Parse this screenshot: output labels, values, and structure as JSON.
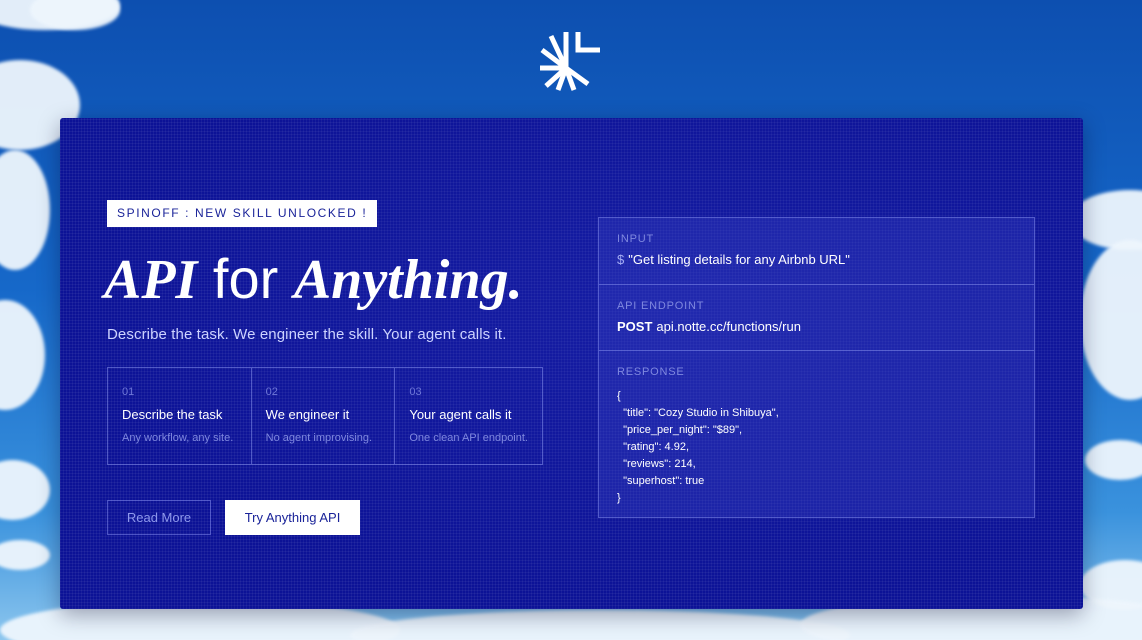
{
  "brand": {
    "logo_icon": "spinoff-starburst-logo-icon"
  },
  "hero": {
    "badge": "SPINOFF : NEW SKILL UNLOCKED !",
    "headline": {
      "part1": "API",
      "part2": " for ",
      "part3": "Anything."
    },
    "subtitle": "Describe the task. We engineer the skill. Your agent calls it."
  },
  "steps": [
    {
      "number": "01",
      "title": "Describe the task",
      "description": "Any workflow, any site."
    },
    {
      "number": "02",
      "title": "We engineer it",
      "description": "No agent improvising."
    },
    {
      "number": "03",
      "title": "Your agent calls it",
      "description": "One clean API endpoint."
    }
  ],
  "actions": {
    "read_more": "Read More",
    "try": "Try Anything API"
  },
  "example": {
    "input": {
      "label": "INPUT",
      "prompt_symbol": "$",
      "value": "\"Get listing details for any Airbnb URL\""
    },
    "endpoint": {
      "label": "API ENDPOINT",
      "method": "POST",
      "url": "api.notte.cc/functions/run"
    },
    "response": {
      "label": "RESPONSE",
      "body": "{\n  \"title\": \"Cozy Studio in Shibuya\",\n  \"price_per_night\": \"$89\",\n  \"rating\": 4.92,\n  \"reviews\": 214,\n  \"superhost\": true\n}"
    }
  },
  "colors": {
    "card": "#0c1296",
    "sky": "#1668c9",
    "accent_text": "#7f88df"
  }
}
